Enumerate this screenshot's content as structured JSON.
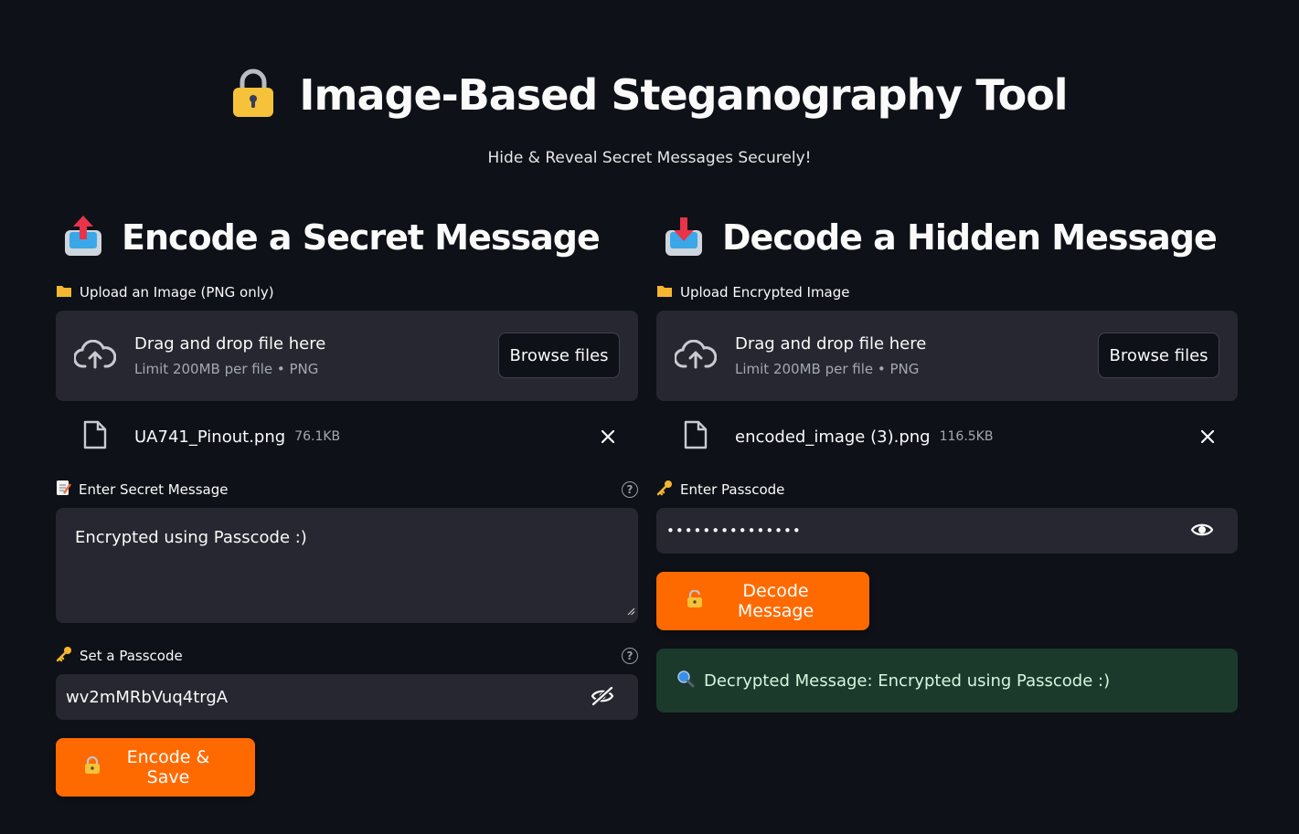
{
  "header": {
    "title": "Image-Based Steganography Tool",
    "subtitle": "Hide & Reveal Secret Messages Securely!",
    "icon": "lock-icon"
  },
  "encode": {
    "title": "Encode a Secret Message",
    "upload_label": "Upload an Image (PNG only)",
    "dropzone_main": "Drag and drop file here",
    "dropzone_sub": "Limit 200MB per file • PNG",
    "browse_label": "Browse files",
    "file_name": "UA741_Pinout.png",
    "file_size": "76.1KB",
    "message_label": "Enter Secret Message",
    "message_value": "Encrypted using Passcode :)",
    "passcode_label": "Set a Passcode",
    "passcode_value": "wv2mMRbVuq4trgA",
    "button_label": "Encode & Save"
  },
  "decode": {
    "title": "Decode a Hidden Message",
    "upload_label": "Upload Encrypted Image",
    "dropzone_main": "Drag and drop file here",
    "dropzone_sub": "Limit 200MB per file • PNG",
    "browse_label": "Browse files",
    "file_name": "encoded_image (3).png",
    "file_size": "116.5KB",
    "passcode_label": "Enter Passcode",
    "passcode_masked": "•••••••••••••••",
    "button_label": "Decode Message",
    "result_text": "Decrypted Message: Encrypted using Passcode :)"
  },
  "colors": {
    "background": "#0e1117",
    "surface": "#262730",
    "accent": "#ff6a00",
    "success_bg": "#1b3a2c"
  }
}
